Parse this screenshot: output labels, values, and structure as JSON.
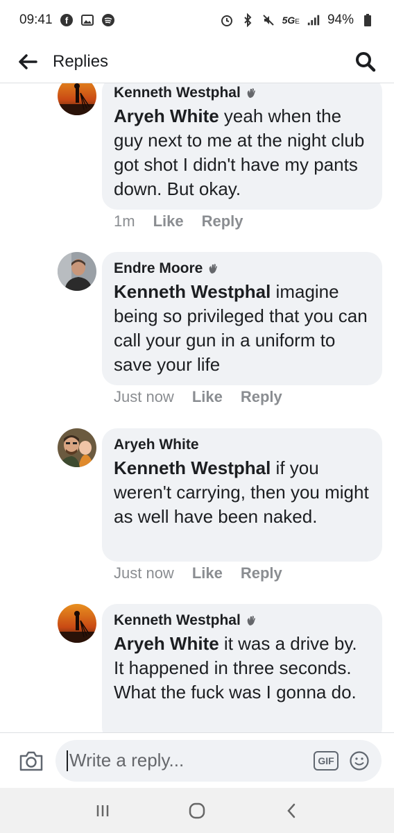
{
  "status_bar": {
    "time": "09:41",
    "network": "5G",
    "network_sub": "E",
    "battery": "94%"
  },
  "app_bar": {
    "title": "Replies"
  },
  "comments": [
    {
      "author": "Kenneth Westphal",
      "mention": "Aryeh White",
      "body": " yeah when the guy next to me at the night club got shot I didn't have my pants down. But okay.",
      "time": "1m",
      "like": "Like",
      "reply": "Reply",
      "avatar": "sunset-photographer-avatar"
    },
    {
      "author": "Endre Moore",
      "mention": "Kenneth Westphal",
      "body": " imagine being so privileged that you can call your gun in a uniform to save your life",
      "time": "Just now",
      "like": "Like",
      "reply": "Reply",
      "avatar": "man-portrait-avatar"
    },
    {
      "author": "Aryeh White",
      "mention": "Kenneth Westphal",
      "body": " if you weren't carrying, then you might as well have been naked.",
      "time": "Just now",
      "like": "Like",
      "reply": "Reply",
      "avatar": "father-child-avatar"
    },
    {
      "author": "Kenneth Westphal",
      "mention": "Aryeh White",
      "body": " it was a drive by. It happened in three seconds. What the fuck was I gonna do.",
      "time": "",
      "like": "",
      "reply": "",
      "avatar": "sunset-photographer-avatar"
    }
  ],
  "composer": {
    "placeholder": "Write a reply...",
    "gif_label": "GIF"
  },
  "colors": {
    "bubble": "#f0f2f5",
    "meta_text": "#8a8d91",
    "primary_text": "#1c1e21"
  }
}
